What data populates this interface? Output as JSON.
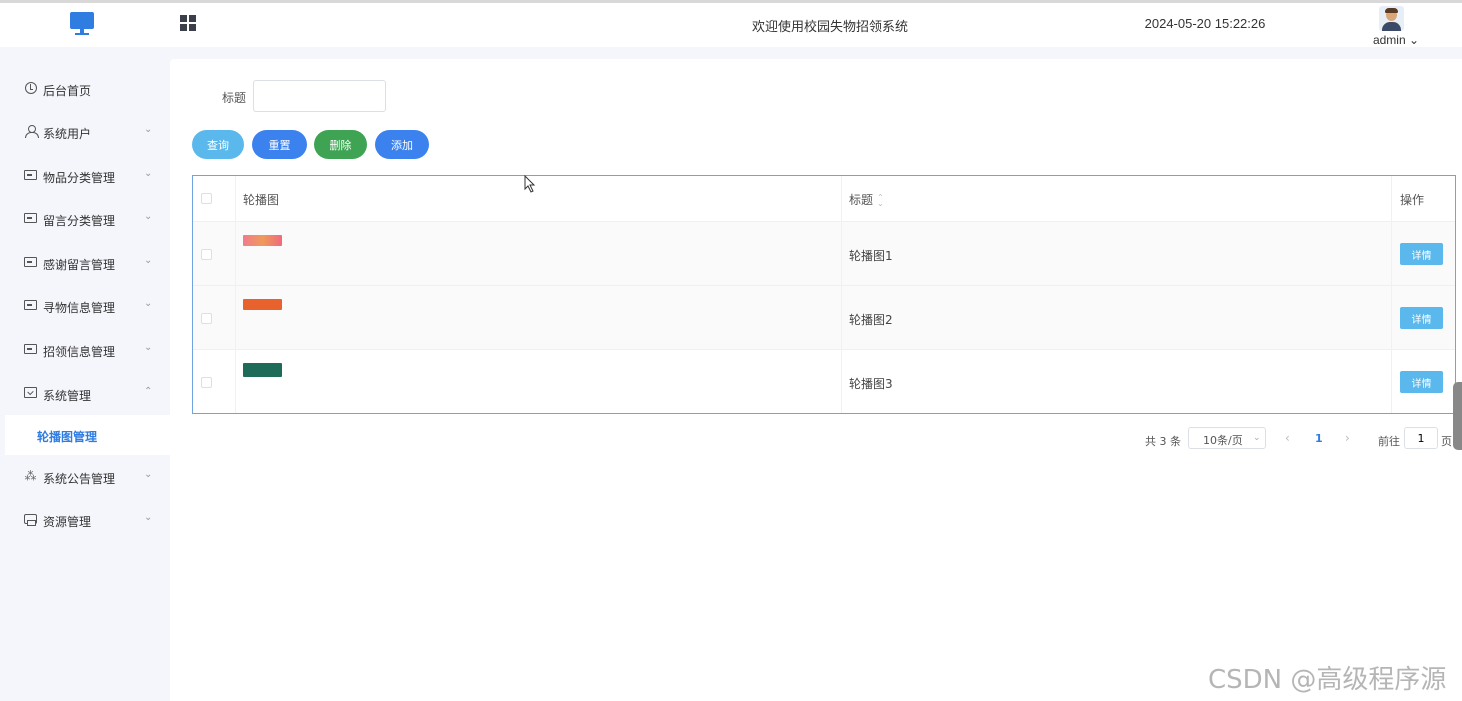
{
  "header": {
    "title": "欢迎使用校园失物招领系统",
    "datetime": "2024-05-20 15:22:26",
    "user_name": "admin",
    "user_chevron": "⌄"
  },
  "sidebar": {
    "items": [
      {
        "label": "后台首页",
        "icon": "clock-icon",
        "arrow": ""
      },
      {
        "label": "系统用户",
        "icon": "user-icon",
        "arrow": "⌄"
      },
      {
        "label": "物品分类管理",
        "icon": "card-icon",
        "arrow": "⌄"
      },
      {
        "label": "留言分类管理",
        "icon": "card-icon",
        "arrow": "⌄"
      },
      {
        "label": "感谢留言管理",
        "icon": "card-icon",
        "arrow": "⌄"
      },
      {
        "label": "寻物信息管理",
        "icon": "card-icon",
        "arrow": "⌄"
      },
      {
        "label": "招领信息管理",
        "icon": "card-icon",
        "arrow": "⌄"
      },
      {
        "label": "系统管理",
        "icon": "folder-check-icon",
        "arrow": "⌃"
      },
      {
        "label": "系统公告管理",
        "icon": "spinner-icon",
        "arrow": "⌄"
      },
      {
        "label": "资源管理",
        "icon": "printer-icon",
        "arrow": "⌄"
      }
    ],
    "active_sub": "轮播图管理"
  },
  "search": {
    "label": "标题",
    "value": "",
    "placeholder": ""
  },
  "buttons": {
    "query": "查询",
    "reset": "重置",
    "delete": "删除",
    "add": "添加"
  },
  "table": {
    "columns": [
      "轮播图",
      "标题",
      "操作"
    ],
    "rows": [
      {
        "title": "轮播图1",
        "action": "详情",
        "thumb_color": "#ef8a70"
      },
      {
        "title": "轮播图2",
        "action": "详情",
        "thumb_color": "#e8622e"
      },
      {
        "title": "轮播图3",
        "action": "详情",
        "thumb_color": "#1e6b5a"
      }
    ]
  },
  "pagination": {
    "total": "共 3 条",
    "page_size": "10条/页",
    "current": "1",
    "goto_label": "前往",
    "goto_value": "1",
    "page_suffix": "页",
    "prev": "‹",
    "next": "›"
  },
  "colors": {
    "accent": "#3c82ef",
    "query": "#5bb8ec",
    "delete": "#3ea454"
  },
  "watermark": "CSDN @高级程序源"
}
